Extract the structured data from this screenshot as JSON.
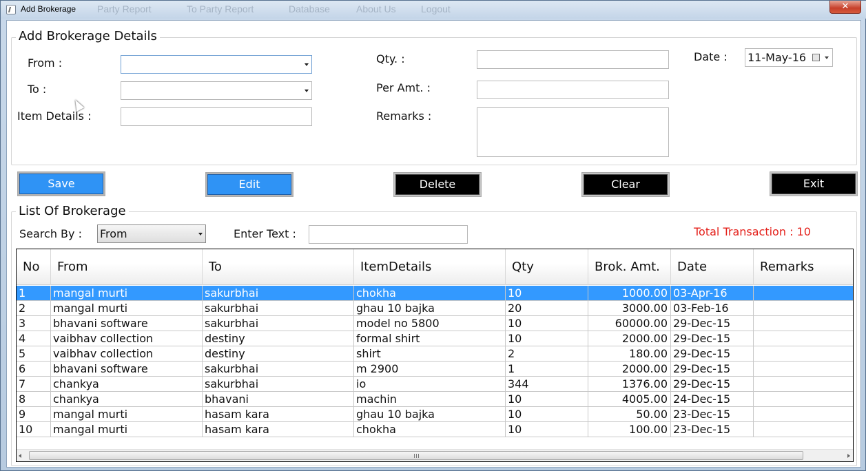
{
  "window": {
    "title": "Add Brokerage",
    "close_label": "✕",
    "background_menu": [
      "Party Report",
      "To Party Report",
      "Database",
      "About Us",
      "Logout"
    ]
  },
  "details": {
    "heading": "Add Brokerage Details",
    "from_label": "From :",
    "from_value": "",
    "to_label": "To :",
    "to_value": "",
    "item_details_label": "Item Details :",
    "item_details_value": "",
    "qty_label": "Qty. :",
    "qty_value": "",
    "per_amt_label": "Per Amt. :",
    "per_amt_value": "",
    "remarks_label": "Remarks :",
    "remarks_value": "",
    "date_label": "Date :",
    "date_value": "11-May-16"
  },
  "buttons": {
    "save": "Save",
    "edit": "Edit",
    "delete": "Delete",
    "clear": "Clear",
    "exit": "Exit"
  },
  "list": {
    "heading": "List Of Brokerage",
    "search_by_label": "Search By :",
    "search_by_value": "From",
    "enter_text_label": "Enter Text :",
    "enter_text_value": "",
    "total_transaction": "Total Transaction : 10",
    "columns": [
      "No",
      "From",
      "To",
      "ItemDetails",
      "Qty",
      "Brok. Amt.",
      "Date",
      "Remarks"
    ],
    "rows": [
      [
        "1",
        "mangal murti",
        "sakurbhai",
        "chokha",
        "10",
        "1000.00",
        "03-Apr-16",
        ""
      ],
      [
        "2",
        "mangal murti",
        "sakurbhai",
        "ghau 10 bajka",
        "20",
        "3000.00",
        "03-Feb-16",
        ""
      ],
      [
        "3",
        "bhavani software",
        "sakurbhai",
        "model no 5800",
        "10",
        "60000.00",
        "29-Dec-15",
        ""
      ],
      [
        "4",
        "vaibhav collection",
        "destiny",
        "formal shirt",
        "10",
        "2000.00",
        "29-Dec-15",
        ""
      ],
      [
        "5",
        "vaibhav collection",
        "destiny",
        "shirt",
        "2",
        "180.00",
        "29-Dec-15",
        ""
      ],
      [
        "6",
        "bhavani software",
        "sakurbhai",
        "m 2900",
        "1",
        "2000.00",
        "29-Dec-15",
        ""
      ],
      [
        "7",
        "chankya",
        "sakurbhai",
        "io",
        "344",
        "1376.00",
        "29-Dec-15",
        ""
      ],
      [
        "8",
        "chankya",
        "bhavani",
        "machin",
        "10",
        "4005.00",
        "24-Dec-15",
        ""
      ],
      [
        "9",
        "mangal murti",
        "hasam kara",
        "ghau 10 bajka",
        "10",
        "50.00",
        "23-Dec-15",
        ""
      ],
      [
        "10",
        "mangal murti",
        "hasam kara",
        "chokha",
        "10",
        "100.00",
        "23-Dec-15",
        ""
      ]
    ],
    "selected_row": 0
  },
  "colors": {
    "button_blue": "#2f93f5",
    "button_black": "#000000",
    "selection": "#3399ff",
    "total_text": "#e4211b"
  }
}
